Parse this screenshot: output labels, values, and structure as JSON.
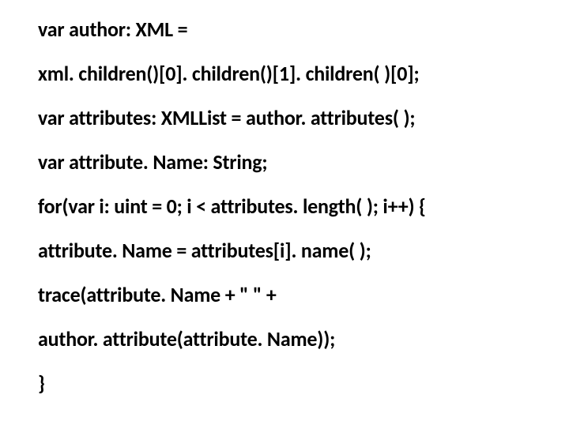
{
  "code": {
    "lines": [
      "var author: XML =",
      "xml. children()[0]. children()[1]. children( )[0];",
      "var attributes: XMLList = author. attributes( );",
      "var attribute. Name: String;",
      "for(var i: uint = 0; i < attributes. length( ); i++) {",
      "attribute. Name = attributes[i]. name( );",
      "trace(attribute. Name + \" \" +",
      "author. attribute(attribute. Name));",
      "}"
    ]
  }
}
